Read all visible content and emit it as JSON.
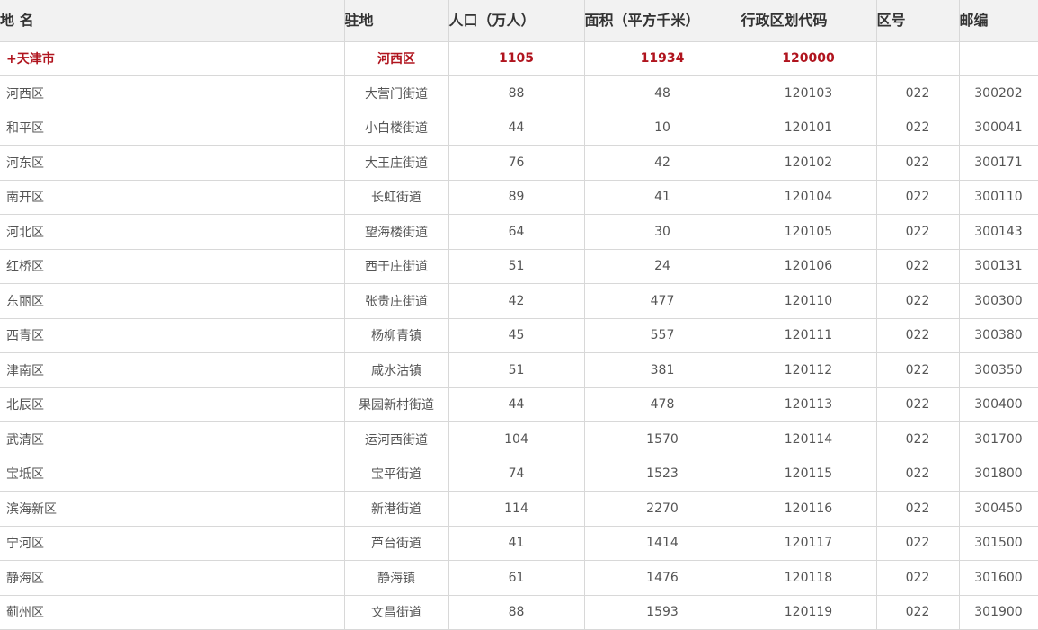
{
  "headers": [
    "地 名",
    "驻地",
    "人口（万人）",
    "面积（平方千米）",
    "行政区划代码",
    "区号",
    "邮编"
  ],
  "summary": {
    "name": "+天津市",
    "seat": "河西区",
    "population": "1105",
    "area": "11934",
    "code": "120000",
    "area_code": "",
    "postcode": ""
  },
  "rows": [
    {
      "name": "河西区",
      "seat": "大营门街道",
      "population": "88",
      "area": "48",
      "code": "120103",
      "area_code": "022",
      "postcode": "300202"
    },
    {
      "name": "和平区",
      "seat": "小白楼街道",
      "population": "44",
      "area": "10",
      "code": "120101",
      "area_code": "022",
      "postcode": "300041"
    },
    {
      "name": "河东区",
      "seat": "大王庄街道",
      "population": "76",
      "area": "42",
      "code": "120102",
      "area_code": "022",
      "postcode": "300171"
    },
    {
      "name": "南开区",
      "seat": "长虹街道",
      "population": "89",
      "area": "41",
      "code": "120104",
      "area_code": "022",
      "postcode": "300110"
    },
    {
      "name": "河北区",
      "seat": "望海楼街道",
      "population": "64",
      "area": "30",
      "code": "120105",
      "area_code": "022",
      "postcode": "300143"
    },
    {
      "name": "红桥区",
      "seat": "西于庄街道",
      "population": "51",
      "area": "24",
      "code": "120106",
      "area_code": "022",
      "postcode": "300131"
    },
    {
      "name": "东丽区",
      "seat": "张贵庄街道",
      "population": "42",
      "area": "477",
      "code": "120110",
      "area_code": "022",
      "postcode": "300300"
    },
    {
      "name": "西青区",
      "seat": "杨柳青镇",
      "population": "45",
      "area": "557",
      "code": "120111",
      "area_code": "022",
      "postcode": "300380"
    },
    {
      "name": "津南区",
      "seat": "咸水沽镇",
      "population": "51",
      "area": "381",
      "code": "120112",
      "area_code": "022",
      "postcode": "300350"
    },
    {
      "name": "北辰区",
      "seat": "果园新村街道",
      "population": "44",
      "area": "478",
      "code": "120113",
      "area_code": "022",
      "postcode": "300400"
    },
    {
      "name": "武清区",
      "seat": "运河西街道",
      "population": "104",
      "area": "1570",
      "code": "120114",
      "area_code": "022",
      "postcode": "301700"
    },
    {
      "name": "宝坻区",
      "seat": "宝平街道",
      "population": "74",
      "area": "1523",
      "code": "120115",
      "area_code": "022",
      "postcode": "301800"
    },
    {
      "name": "滨海新区",
      "seat": "新港街道",
      "population": "114",
      "area": "2270",
      "code": "120116",
      "area_code": "022",
      "postcode": "300450"
    },
    {
      "name": "宁河区",
      "seat": "芦台街道",
      "population": "41",
      "area": "1414",
      "code": "120117",
      "area_code": "022",
      "postcode": "301500"
    },
    {
      "name": "静海区",
      "seat": "静海镇",
      "population": "61",
      "area": "1476",
      "code": "120118",
      "area_code": "022",
      "postcode": "301600"
    },
    {
      "name": "蓟州区",
      "seat": "文昌街道",
      "population": "88",
      "area": "1593",
      "code": "120119",
      "area_code": "022",
      "postcode": "301900"
    }
  ]
}
